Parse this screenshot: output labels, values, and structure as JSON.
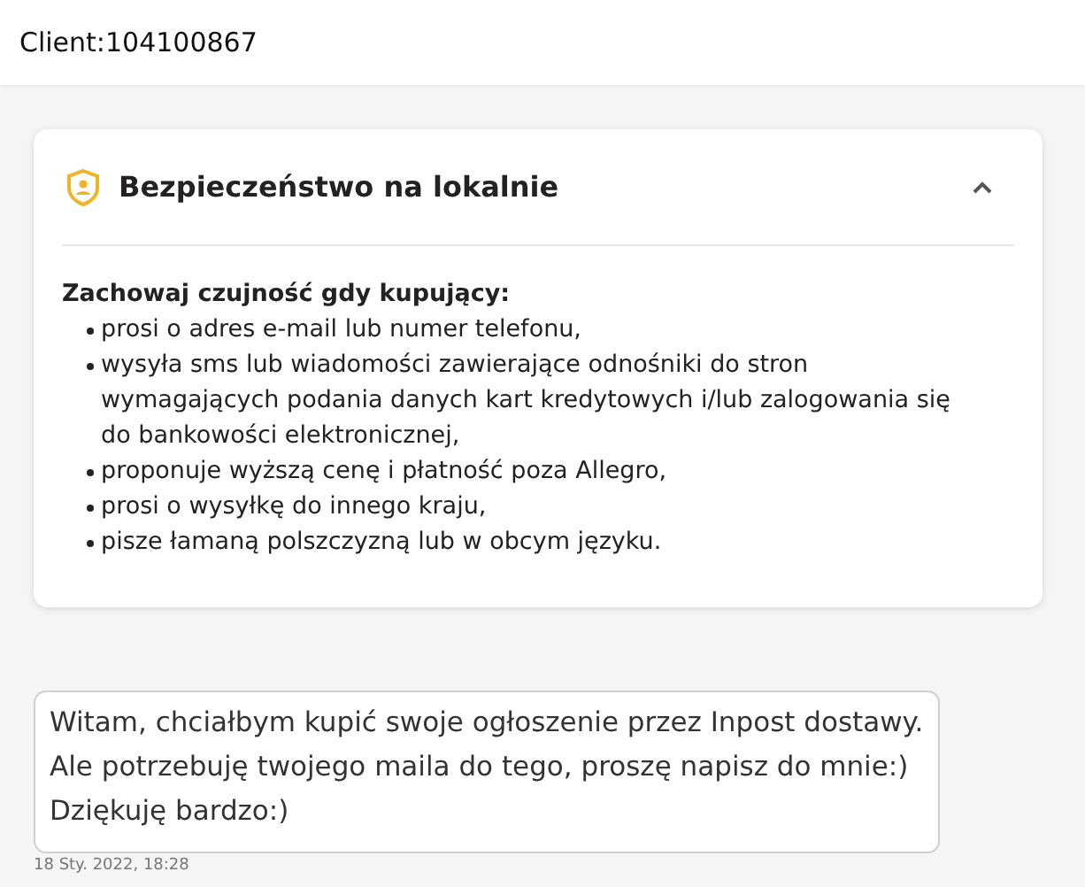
{
  "header": {
    "title": "Client:104100867"
  },
  "safety_panel": {
    "title": "Bezpieczeństwo na lokalnie",
    "expanded": true,
    "heading": "Zachowaj czujność gdy kupujący:",
    "items": [
      "prosi o adres e-mail lub numer telefonu,",
      "wysyła sms lub wiadomości zawierające odnośniki do stron wymagających podania danych kart kredytowych i/lub zalogowania się do bankowości elektronicznej,",
      "proponuje wyższą cenę i płatność poza Allegro,",
      "prosi o wysyłkę do innego kraju,",
      "pisze łamaną polszczyzną lub w obcym języku."
    ]
  },
  "messages": [
    {
      "lines": [
        "Witam, chciałbym kupić swoje ogłoszenie przez Inpost dostawy.",
        "Ale potrzebuję twojego maila do tego, proszę napisz do mnie:)",
        "Dziękuję bardzo:)"
      ],
      "time": "18 Sty. 2022, 18:28"
    }
  ]
}
